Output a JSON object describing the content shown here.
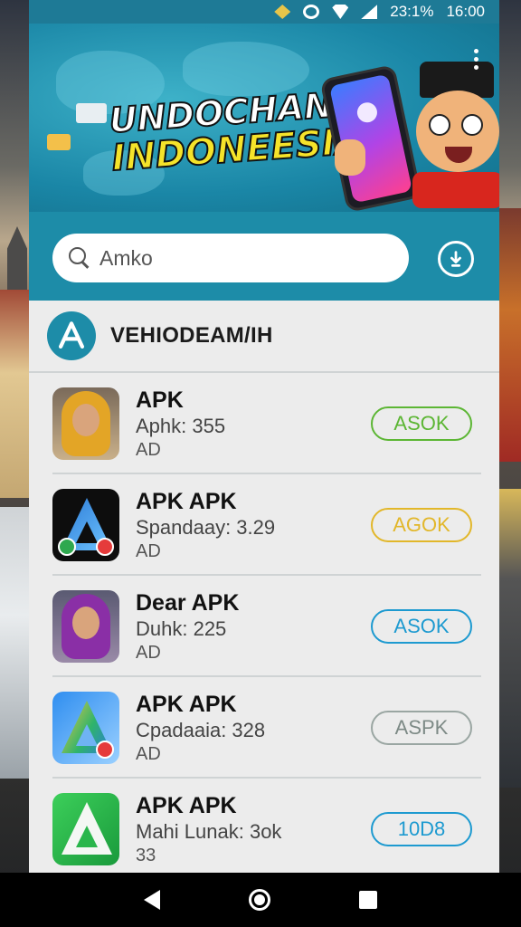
{
  "status_bar": {
    "battery": "23:1%",
    "time": "16:00"
  },
  "banner": {
    "title_line1": "UNDOCHAN",
    "title_line2": "INDONEESIAI"
  },
  "search": {
    "value": "Amko",
    "placeholder": "Amko"
  },
  "section": {
    "title": "VEHIODEAM/IH"
  },
  "apps": [
    {
      "name": "APK",
      "meta": "Aphk: 355",
      "ad": "AD",
      "action": "ASOK",
      "action_color": "#5cb634",
      "icon": "woman-yellow-hijab-avatar"
    },
    {
      "name": "APK APK",
      "meta": "Spandaay: 3.29",
      "ad": "AD",
      "action": "AGOK",
      "action_color": "#e2b72a",
      "icon": "blue-triangle-app-icon"
    },
    {
      "name": "Dear APK",
      "meta": "Duhk: 225",
      "ad": "AD",
      "action": "ASOK",
      "action_color": "#1d9ad0",
      "icon": "woman-purple-hijab-avatar"
    },
    {
      "name": "APK APK",
      "meta": "Cpadaaia: 328",
      "ad": "AD",
      "action": "ASPK",
      "action_color": "#9aa6a2",
      "icon": "gradient-triangle-app-icon"
    },
    {
      "name": "APK APK",
      "meta": "Mahi Lunak: 3ok",
      "ad": "33",
      "action": "10D8",
      "action_color": "#1d9ad0",
      "icon": "green-triangle-app-icon"
    }
  ],
  "colors": {
    "accent": "#1d8ca8",
    "banner_yellow": "#f5e32a"
  }
}
